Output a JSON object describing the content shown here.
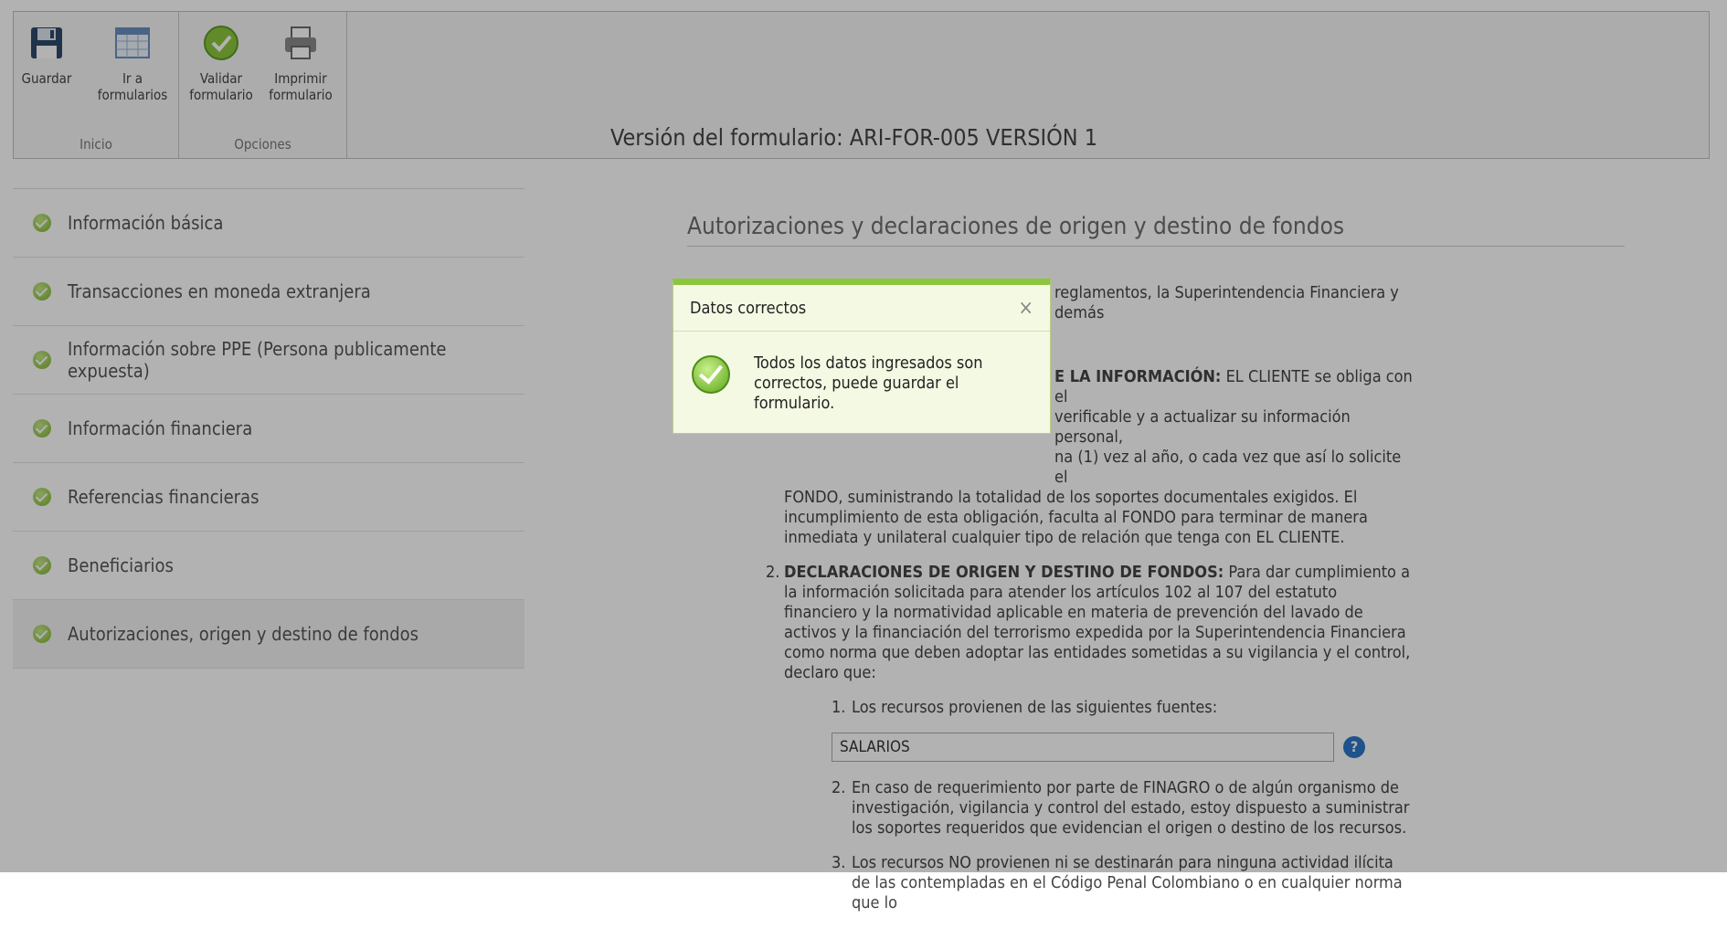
{
  "ribbon": {
    "buttons": {
      "save": "Guardar",
      "goto_line1": "Ir a",
      "goto_line2": "formularios",
      "validate_line1": "Validar",
      "validate_line2": "formulario",
      "print_line1": "Imprimir",
      "print_line2": "formulario"
    },
    "group_inicio": "Inicio",
    "group_opciones": "Opciones"
  },
  "version": "Versión del formulario: ARI-FOR-005 VERSIÓN 1",
  "sidebar": {
    "items": [
      {
        "label": "Información básica"
      },
      {
        "label": "Transacciones en moneda extranjera"
      },
      {
        "label": "Información sobre PPE (Persona publicamente expuesta)"
      },
      {
        "label": "Información financiera"
      },
      {
        "label": "Referencias financieras"
      },
      {
        "label": "Beneficiarios"
      },
      {
        "label": "Autorizaciones, origen y destino de fondos"
      }
    ]
  },
  "main": {
    "title": "Autorizaciones y declaraciones de origen y destino de fondos",
    "intro_visible": "reglamentos, la Superintendencia Financiera y demás",
    "item1_heading_visible": "E LA INFORMACIÓN:",
    "item1_text_line1": "EL CLIENTE se obliga con el",
    "item1_text_line2": "verificable y a actualizar su información personal,",
    "item1_text_line3": "na (1) vez al año, o cada vez que así lo solicite el",
    "item1_text_rest": "FONDO, suministrando la totalidad de los soportes documentales exigidos. El incumplimiento de esta obligación, faculta al FONDO para terminar de manera inmediata y unilateral cualquier tipo de relación que tenga con EL CLIENTE.",
    "item2_number": "2.",
    "item2_heading": "DECLARACIONES DE ORIGEN Y DESTINO DE FONDOS:",
    "item2_text": "Para dar cumplimiento a la información solicitada para atender los artículos 102 al 107 del estatuto financiero y la normatividad aplicable en materia de prevención del lavado de activos y la financiación del terrorismo expedida por la Superintendencia Financiera como norma que deben adoptar las entidades sometidas a su vigilancia y el control, declaro que:",
    "sub1_number": "1.",
    "sub1_text": "Los recursos provienen de las siguientes fuentes:",
    "sources_value": "SALARIOS",
    "help_glyph": "?",
    "sub2_number": "2.",
    "sub2_text": "En caso de requerimiento por parte de FINAGRO o de algún organismo de investigación, vigilancia y control del estado, estoy dispuesto a suministrar los soportes requeridos que evidencian el origen o destino de los recursos.",
    "sub3_number": "3.",
    "sub3_text": "Los recursos NO provienen ni se destinarán para ninguna actividad ilícita de las contempladas en el Código Penal Colombiano o en cualquier norma que lo"
  },
  "modal": {
    "title": "Datos correctos",
    "close_glyph": "×",
    "message": "Todos los datos ingresados son correctos, puede guardar el formulario."
  }
}
